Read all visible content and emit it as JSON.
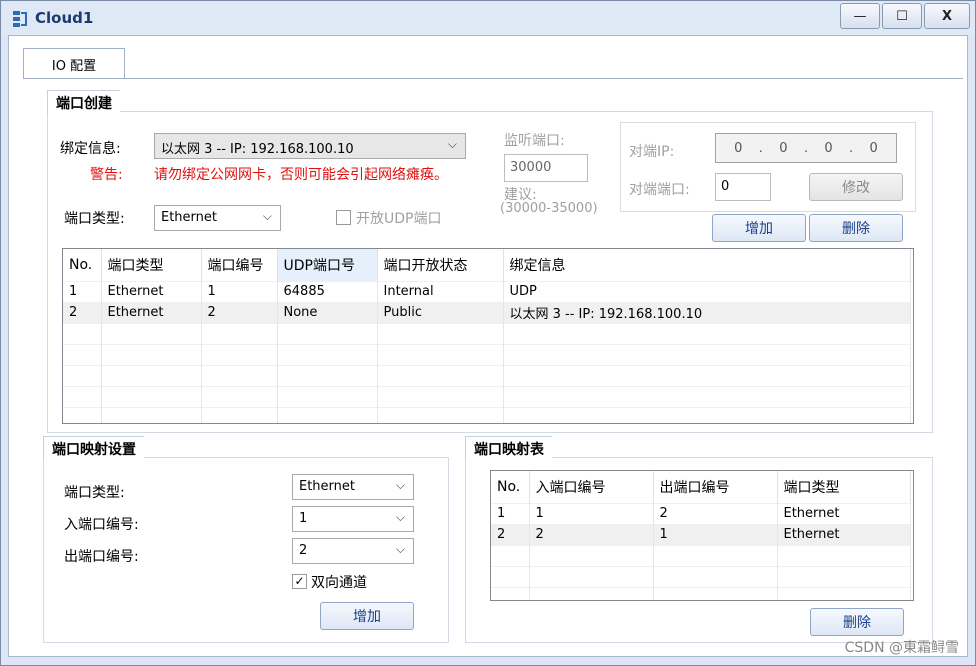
{
  "window": {
    "title": "Cloud1",
    "min_glyph": "—",
    "max_glyph": "☐",
    "close_glyph": "X"
  },
  "tabs": [
    {
      "label": "IO 配置"
    }
  ],
  "port_creation": {
    "title": "端口创建",
    "bind_label": "绑定信息:",
    "bind_value": "以太网 3 -- IP: 192.168.100.10",
    "warning_label": "警告:",
    "warning_text": "请勿绑定公网网卡，否则可能会引起网络瘫痪。",
    "port_type_label": "端口类型:",
    "port_type_value": "Ethernet",
    "udp_open_label": "开放UDP端口",
    "listen_port_label": "监听端口:",
    "listen_port_value": "30000",
    "suggest_label": "建议:",
    "suggest_range": "(30000-35000)",
    "peer_ip_label": "对端IP:",
    "peer_ip_octets": [
      "0",
      "0",
      "0",
      "0"
    ],
    "peer_port_label": "对端端口:",
    "peer_port_value": "0",
    "modify_button": "修改",
    "add_button": "增加",
    "delete_button": "删除",
    "table": {
      "columns": [
        "No.",
        "端口类型",
        "端口编号",
        "UDP端口号",
        "端口开放状态",
        "绑定信息"
      ],
      "rows": [
        [
          "1",
          "Ethernet",
          "1",
          "64885",
          "Internal",
          "UDP"
        ],
        [
          "2",
          "Ethernet",
          "2",
          "None",
          "Public",
          "以太网 3 -- IP: 192.168.100.10"
        ]
      ]
    }
  },
  "port_mapping": {
    "title": "端口映射设置",
    "type_label": "端口类型:",
    "type_value": "Ethernet",
    "in_label": "入端口编号:",
    "in_value": "1",
    "out_label": "出端口编号:",
    "out_value": "2",
    "bidirectional_label": "双向通道",
    "bidirectional_checked": true,
    "add_button": "增加"
  },
  "mapping_table": {
    "title": "端口映射表",
    "columns": [
      "No.",
      "入端口编号",
      "出端口编号",
      "端口类型"
    ],
    "rows": [
      [
        "1",
        "1",
        "2",
        "Ethernet"
      ],
      [
        "2",
        "2",
        "1",
        "Ethernet"
      ]
    ],
    "delete_button": "删除"
  },
  "watermark": "CSDN @東霜鲟雪",
  "colors": {
    "accent": "#1a3f8a",
    "warning": "#e01010",
    "title_text": "#1b3b70"
  }
}
